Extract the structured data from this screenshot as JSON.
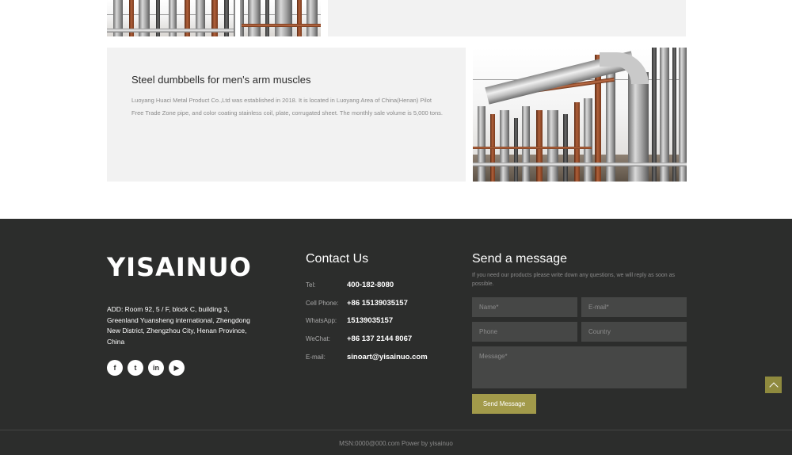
{
  "card": {
    "title": "Steel dumbbells for men's arm muscles",
    "description": "Luoyang Huaci Metal Product Co.,Ltd was established in 2018. It is located in Luoyang Area of China(Henan) Pilot Free Trade Zone pipe, and color coating stainless coil, plate, corrugated sheet. The monthly sale volume is 5,000 tons."
  },
  "footer": {
    "logo_text": "YISAINUO",
    "address": "ADD: Room 92, 5 / F, block C, building 3, Greenland Yuansheng international, Zhengdong New District, Zhengzhou City, Henan Province, China",
    "social": [
      {
        "name": "facebook-icon",
        "glyph": "f"
      },
      {
        "name": "twitter-icon",
        "glyph": "t"
      },
      {
        "name": "linkedin-icon",
        "glyph": "in"
      },
      {
        "name": "youtube-icon",
        "glyph": "▶"
      }
    ],
    "contact": {
      "title": "Contact Us",
      "rows": [
        {
          "label": "Tel:",
          "value": "400-182-8080"
        },
        {
          "label": "Cell Phone:",
          "value": "+86 15139035157"
        },
        {
          "label": "WhatsApp:",
          "value": "15139035157"
        },
        {
          "label": "WeChat:",
          "value": "+86 137 2144 8067"
        },
        {
          "label": "E-mail:",
          "value": "sinoart@yisainuo.com"
        }
      ]
    },
    "message": {
      "title": "Send a message",
      "description": "If you need our products please write down any questions, we will reply as soon as possible.",
      "name_placeholder": "Name*",
      "email_placeholder": "E-mail*",
      "phone_placeholder": "Phone",
      "country_placeholder": "Country",
      "message_placeholder": "Message*",
      "send_label": "Send Message"
    },
    "copyright": "MSN:0000@000.com Power by yisainuo"
  },
  "colors": {
    "footer_bg": "#2c2d2c",
    "accent": "#a29a4a",
    "card_bg": "#f2f2f2"
  }
}
